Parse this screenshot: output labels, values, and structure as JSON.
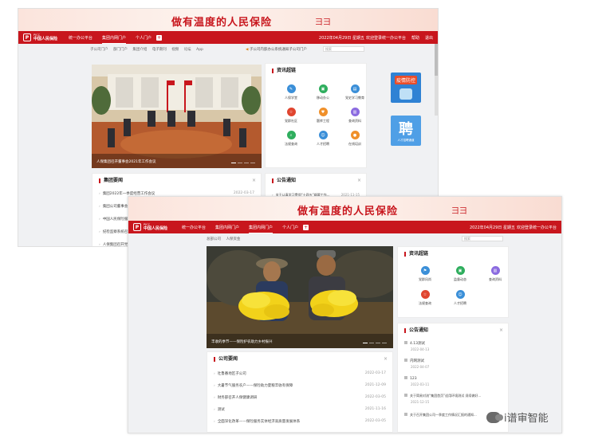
{
  "banner": {
    "slogan": "做有温度的人民保险"
  },
  "navbar": {
    "logo_mark": "P",
    "logo_en": "PICC",
    "logo_cn": "中国人民保险",
    "items": [
      "统一办公平台",
      "集团内网门户",
      "个人门户"
    ],
    "plus": "+",
    "date_text": "2022年04月29日 星期五",
    "win1_welcome": "欢迎登录统一办公平台",
    "win2_welcome": "欢迎登录统一办公平台",
    "links": [
      "帮助",
      "退出"
    ]
  },
  "win1": {
    "crumbs": [
      "子公司门户",
      "部门门户",
      "集团介绍",
      "电子期刊",
      "视频",
      "论坛",
      "App"
    ],
    "notice": "子公司内部办公系统通知子公司门户",
    "search_placeholder": "搜索",
    "photo_caption": "人保集团召开董事会2021年工作会议",
    "quick_title": "资讯超链",
    "quick_tiles": [
      "人保学堂",
      "移动办公",
      "党史学习教育",
      "党群社区",
      "题库工程",
      "查询资料",
      "法规查询",
      "人才招聘",
      "在线培训"
    ],
    "group_news_title": "集团要闻",
    "group_news": [
      {
        "title": "集团2022年一季度经营工作会议",
        "date": "2022-03-17"
      },
      {
        "title": "集团公司董事会审议通过年报",
        "date": ""
      },
      {
        "title": "中国人民保险服务乡村振兴",
        "date": ""
      },
      {
        "title": "纪检监察系统召开专题会议",
        "date": ""
      },
      {
        "title": "人保集团召开党委理论学习会",
        "date": ""
      }
    ],
    "notice_title": "公告通知",
    "notice_rows": [
      {
        "title": "关于认真学习贯彻“十四五”纲要工作...",
        "date": "2021-11-15"
      }
    ],
    "ads": [
      "疫情防控",
      "聘"
    ],
    "ad_sub": "人才招聘通道"
  },
  "win2": {
    "crumbs": [
      "总部公司",
      "人保资金"
    ],
    "search_placeholder": "搜索",
    "photo_caption": "丰收的季节——保险护农助力乡村振兴",
    "quick_title": "资讯超链",
    "quick_tiles": [
      "党群风尚",
      "监督动态",
      "查询资料",
      "法规查询",
      "人才招聘"
    ],
    "company_news_title": "公司要闻",
    "company_news": [
      {
        "title": "吐鲁番地区子公司",
        "date": "2022-03-17"
      },
      {
        "title": "大暑节气服务农户——保险助力夏粮丰收有保障",
        "date": "2021-12-09"
      },
      {
        "title": "财务部召开人保健康调研",
        "date": "2022-03-05"
      },
      {
        "title": "测试",
        "date": "2021-11-16"
      },
      {
        "title": "全面深化改革——保险服务实体经济高质量发展体系",
        "date": "2022-03-05"
      }
    ],
    "notice_title": "公告通知",
    "notice_rows": [
      {
        "title": "4.13测试",
        "date": "2022-04-13"
      },
      {
        "title": "内网测试",
        "date": "2022-04-07"
      },
      {
        "title": "123",
        "date": "2022-03-11"
      },
      {
        "title": "关于简易对流“集团首页”适用环境测试 须续做好...",
        "date": "2021-12-15"
      },
      {
        "title": "关于召开集团公司一季度工作情况汇报的通知...",
        "date": ""
      }
    ]
  },
  "watermark": "i谱审智能",
  "colors": {
    "brand_red": "#c8161d",
    "banner_pink": "#fbe4dc",
    "page_gray": "#f0f1f3"
  }
}
